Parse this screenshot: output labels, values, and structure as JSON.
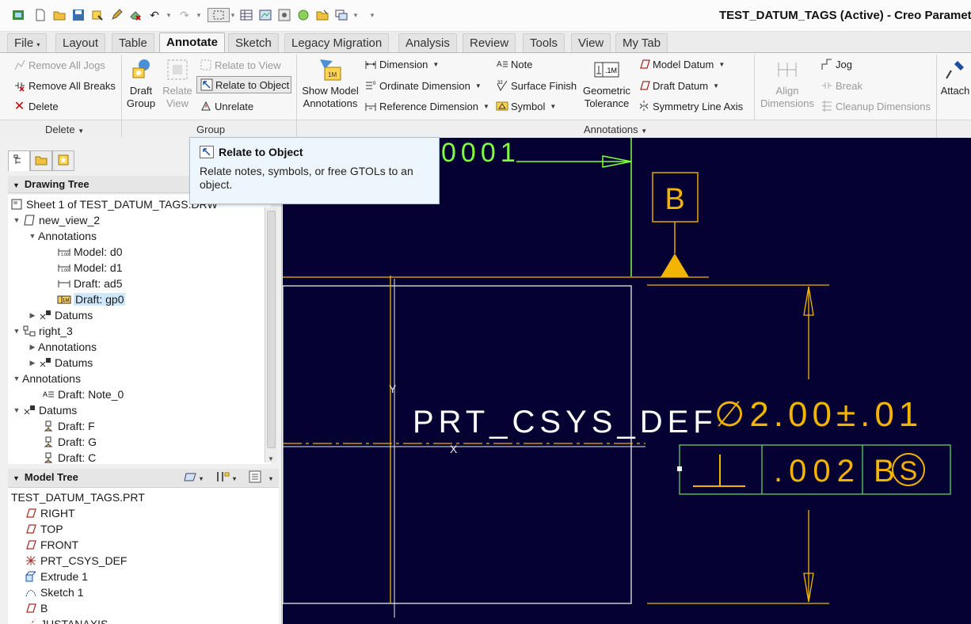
{
  "window_title": "TEST_DATUM_TAGS (Active) - Creo Parametric",
  "tabs": [
    "File",
    "Layout",
    "Table",
    "Annotate",
    "Sketch",
    "Legacy Migration",
    "Analysis",
    "Review",
    "Tools",
    "View",
    "My Tab"
  ],
  "active_tab": "Annotate",
  "ribbon": {
    "delete_group": {
      "remove_all_jogs": "Remove All Jogs",
      "remove_all_breaks": "Remove All Breaks",
      "delete": "Delete",
      "label": "Delete"
    },
    "group_group": {
      "draft_group": "Draft\nGroup",
      "relate_view": "Relate\nView",
      "relate_to_view": "Relate to View",
      "relate_to_object": "Relate to Object",
      "unrelate": "Unrelate",
      "label": "Group"
    },
    "annotations_group": {
      "show_model_annotations": "Show Model\nAnnotations",
      "dimension": "Dimension",
      "ordinate_dimension": "Ordinate Dimension",
      "reference_dimension": "Reference Dimension",
      "note": "Note",
      "surface_finish": "Surface Finish",
      "symbol": "Symbol",
      "geometric_tolerance": "Geometric\nTolerance",
      "model_datum": "Model Datum",
      "draft_datum": "Draft Datum",
      "symmetry_line_axis": "Symmetry Line Axis",
      "align_dimensions": "Align\nDimensions",
      "jog": "Jog",
      "break": "Break",
      "cleanup_dimensions": "Cleanup Dimensions",
      "attach": "Attach",
      "label": "Annotations"
    }
  },
  "tooltip": {
    "title": "Relate to Object",
    "description": "Relate notes, symbols, or free GTOLs to an object."
  },
  "drawing_tree": {
    "header": "Drawing Tree",
    "items": [
      {
        "label": "Sheet 1 of TEST_DATUM_TAGS.DRW",
        "icon": "sheet-icon"
      },
      {
        "label": "new_view_2",
        "icon": "view-icon"
      },
      {
        "label": "Annotations",
        "icon": ""
      },
      {
        "label": "Model: d0",
        "icon": "dimension-icon"
      },
      {
        "label": "Model: d1",
        "icon": "dimension-icon"
      },
      {
        "label": "Draft: ad5",
        "icon": "dimension-icon"
      },
      {
        "label": "Draft: gp0",
        "icon": "gtol-icon"
      },
      {
        "label": "Datums",
        "icon": "datums-icon"
      },
      {
        "label": "right_3",
        "icon": "view-icon"
      },
      {
        "label": "Annotations",
        "icon": ""
      },
      {
        "label": "Datums",
        "icon": "datums-icon"
      },
      {
        "label": "Annotations",
        "icon": ""
      },
      {
        "label": "Draft: Note_0",
        "icon": "note-icon"
      },
      {
        "label": "Datums",
        "icon": "datums-icon"
      },
      {
        "label": "Draft: F",
        "icon": "datum-tag-icon"
      },
      {
        "label": "Draft: G",
        "icon": "datum-tag-icon"
      },
      {
        "label": "Draft: C",
        "icon": "datum-tag-icon"
      }
    ]
  },
  "model_tree": {
    "header": "Model Tree",
    "items": [
      {
        "label": "TEST_DATUM_TAGS.PRT",
        "icon": ""
      },
      {
        "label": "RIGHT",
        "icon": "datum-plane-icon"
      },
      {
        "label": "TOP",
        "icon": "datum-plane-icon"
      },
      {
        "label": "FRONT",
        "icon": "datum-plane-icon"
      },
      {
        "label": "PRT_CSYS_DEF",
        "icon": "csys-icon"
      },
      {
        "label": "Extrude 1",
        "icon": "extrude-icon"
      },
      {
        "label": "Sketch 1",
        "icon": "sketch-icon"
      },
      {
        "label": "B",
        "icon": "datum-plane-icon"
      },
      {
        "label": "JUSTANAXIS",
        "icon": "axis-icon"
      }
    ]
  },
  "canvas": {
    "top_number": "0001",
    "datum_label": "B",
    "csys_label": "PRT_CSYS_DEF",
    "axis_y": "Y",
    "axis_x": "X",
    "diameter_dim": "∅2.00±.01",
    "gtol_value": ".002",
    "gtol_datum": "B",
    "gtol_modifier": "S",
    "colors": {
      "background": "#050233",
      "annotation": "#f2b400",
      "geometry": "#ffffff",
      "highlight": "#7fff3f",
      "gtol_frame": "#5fbf5f"
    }
  }
}
